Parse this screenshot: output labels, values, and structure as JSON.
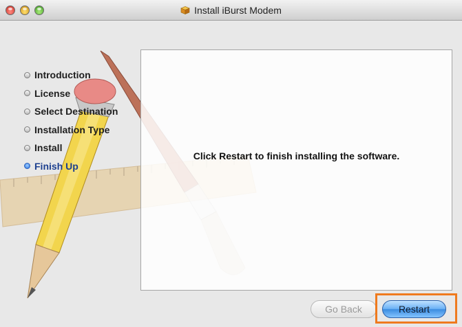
{
  "window": {
    "title": "Install iBurst Modem",
    "title_icon": "package-icon"
  },
  "sidebar": {
    "steps": [
      {
        "label": "Introduction",
        "state": "done"
      },
      {
        "label": "License",
        "state": "done"
      },
      {
        "label": "Select Destination",
        "state": "done"
      },
      {
        "label": "Installation Type",
        "state": "done"
      },
      {
        "label": "Install",
        "state": "done"
      },
      {
        "label": "Finish Up",
        "state": "current"
      }
    ]
  },
  "main": {
    "message": "Click Restart to finish installing the software."
  },
  "buttons": {
    "go_back": {
      "label": "Go Back",
      "enabled": false
    },
    "restart": {
      "label": "Restart",
      "default": true
    }
  },
  "colors": {
    "highlight": "#ef7a1e",
    "active_step": "#1c3f8f",
    "default_button": "#3c8ce0"
  }
}
